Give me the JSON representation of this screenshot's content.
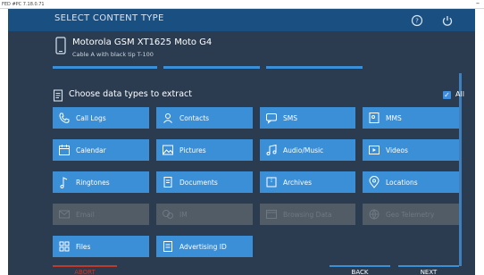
{
  "window": {
    "title": "FED #PC 7.18.0.71",
    "minimize": "–"
  },
  "header": {
    "title": "SELECT CONTENT TYPE"
  },
  "device": {
    "name": "Motorola GSM XT1625 Moto G4",
    "cable": "Cable A with black tip T-100"
  },
  "section": {
    "title": "Choose data types to extract",
    "all_label": "All",
    "all_checked": true
  },
  "types": [
    {
      "label": "Call Logs",
      "icon": "phone-log-icon",
      "enabled": true
    },
    {
      "label": "Contacts",
      "icon": "contacts-icon",
      "enabled": true
    },
    {
      "label": "SMS",
      "icon": "sms-icon",
      "enabled": true
    },
    {
      "label": "MMS",
      "icon": "mms-icon",
      "enabled": true
    },
    {
      "label": "Calendar",
      "icon": "calendar-icon",
      "enabled": true
    },
    {
      "label": "Pictures",
      "icon": "pictures-icon",
      "enabled": true
    },
    {
      "label": "Audio/Music",
      "icon": "music-icon",
      "enabled": true
    },
    {
      "label": "Videos",
      "icon": "video-icon",
      "enabled": true
    },
    {
      "label": "Ringtones",
      "icon": "ringtone-icon",
      "enabled": true
    },
    {
      "label": "Documents",
      "icon": "documents-icon",
      "enabled": true
    },
    {
      "label": "Archives",
      "icon": "archives-icon",
      "enabled": true
    },
    {
      "label": "Locations",
      "icon": "location-icon",
      "enabled": true
    },
    {
      "label": "Email",
      "icon": "email-icon",
      "enabled": false
    },
    {
      "label": "IM",
      "icon": "im-icon",
      "enabled": false
    },
    {
      "label": "Browsing Data",
      "icon": "browsing-icon",
      "enabled": false
    },
    {
      "label": "Geo Telemetry",
      "icon": "geo-icon",
      "enabled": false
    },
    {
      "label": "Files",
      "icon": "files-icon",
      "enabled": true
    },
    {
      "label": "Advertising ID",
      "icon": "ad-id-icon",
      "enabled": true
    }
  ],
  "footer": {
    "abort": "ABORT",
    "back": "BACK",
    "next": "NEXT"
  }
}
